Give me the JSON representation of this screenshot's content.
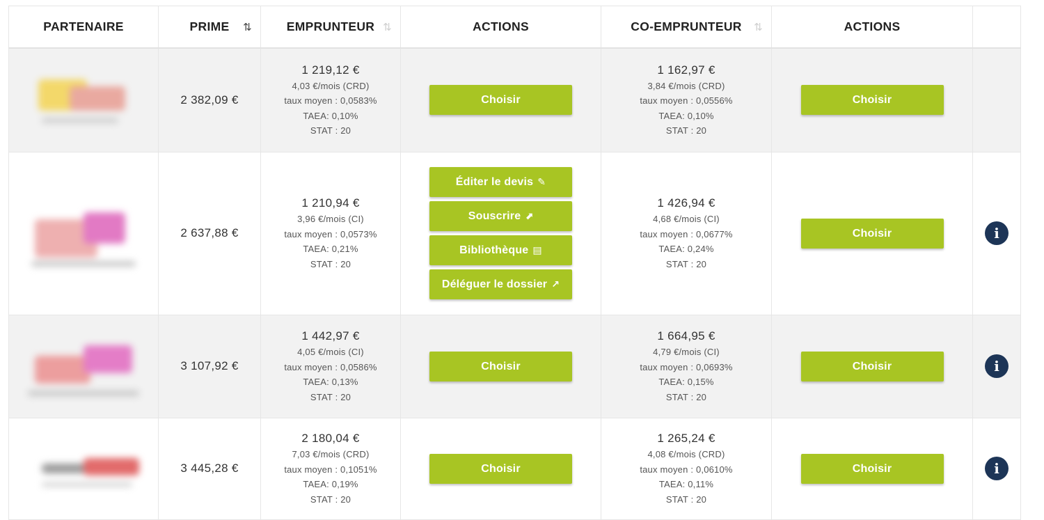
{
  "table": {
    "headers": {
      "partenaire": "PARTENAIRE",
      "prime": "PRIME",
      "emprunteur": "EMPRUNTEUR",
      "actions1": "ACTIONS",
      "coemprunteur": "CO-EMPRUNTEUR",
      "actions2": "ACTIONS",
      "sort_icon": "⇅"
    },
    "rows": [
      {
        "prime": "2 382,09 €",
        "emp": {
          "amount": "1 219,12 €",
          "monthly": "4,03 €/mois (CRD)",
          "taux": "taux moyen : 0,0583%",
          "taea": "TAEA: 0,10%",
          "stat": "STAT : 20"
        },
        "emp_action": "Choisir",
        "co": {
          "amount": "1 162,97 €",
          "monthly": "3,84 €/mois (CRD)",
          "taux": "taux moyen : 0,0556%",
          "taea": "TAEA: 0,10%",
          "stat": "STAT : 20"
        },
        "co_action": "Choisir"
      },
      {
        "prime": "2 637,88 €",
        "emp": {
          "amount": "1 210,94 €",
          "monthly": "3,96 €/mois (CI)",
          "taux": "taux moyen : 0,0573%",
          "taea": "TAEA: 0,21%",
          "stat": "STAT : 20"
        },
        "emp_actions": [
          "Éditer le devis",
          "Souscrire",
          "Bibliothèque",
          "Déléguer le dossier"
        ],
        "co": {
          "amount": "1 426,94 €",
          "monthly": "4,68 €/mois (CI)",
          "taux": "taux moyen : 0,0677%",
          "taea": "TAEA: 0,24%",
          "stat": "STAT : 20"
        },
        "co_action": "Choisir"
      },
      {
        "prime": "3 107,92 €",
        "emp": {
          "amount": "1 442,97 €",
          "monthly": "4,05 €/mois (CI)",
          "taux": "taux moyen : 0,0586%",
          "taea": "TAEA: 0,13%",
          "stat": "STAT : 20"
        },
        "emp_action": "Choisir",
        "co": {
          "amount": "1 664,95 €",
          "monthly": "4,79 €/mois (CI)",
          "taux": "taux moyen : 0,0693%",
          "taea": "TAEA: 0,15%",
          "stat": "STAT : 20"
        },
        "co_action": "Choisir"
      },
      {
        "prime": "3 445,28 €",
        "emp": {
          "amount": "2 180,04 €",
          "monthly": "7,03 €/mois (CRD)",
          "taux": "taux moyen : 0,1051%",
          "taea": "TAEA: 0,19%",
          "stat": "STAT : 20"
        },
        "emp_action": "Choisir",
        "co": {
          "amount": "1 265,24 €",
          "monthly": "4,08 €/mois (CRD)",
          "taux": "taux moyen : 0,0610%",
          "taea": "TAEA: 0,11%",
          "stat": "STAT : 20"
        },
        "co_action": "Choisir"
      }
    ],
    "info_icon": "i",
    "colors": {
      "button": "#a8c523",
      "info": "#1d3557",
      "row_shade": "#f2f2f2"
    }
  }
}
